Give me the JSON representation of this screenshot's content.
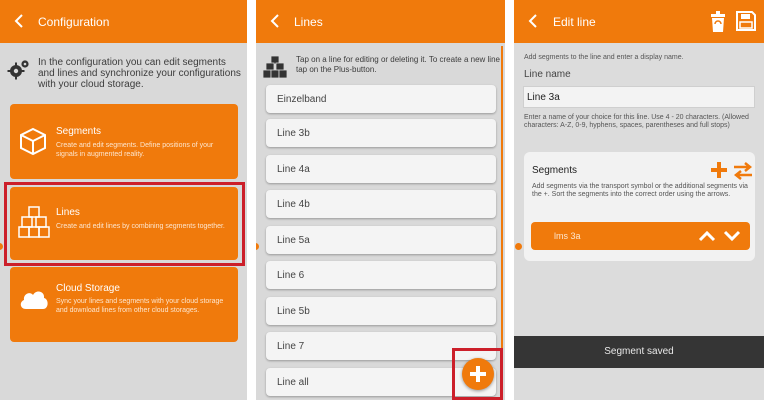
{
  "colors": {
    "accent": "#f07a0c",
    "highlight": "#cc1f2a",
    "toast_bg": "#353535"
  },
  "screen1": {
    "title": "Configuration",
    "intro": "In the configuration you can edit segments and lines and synchronize your configurations with your cloud storage.",
    "cards": [
      {
        "title": "Segments",
        "desc": "Create and edit segments. Define positions of your signals in augmented reality.",
        "icon": "cube-icon"
      },
      {
        "title": "Lines",
        "desc": "Create and edit lines by combining segments together.",
        "icon": "stacked-cubes-icon",
        "highlighted": true
      },
      {
        "title": "Cloud Storage",
        "desc": "Sync your lines and segments with your cloud storage and download lines from other cloud storages.",
        "icon": "cloud-icon"
      }
    ]
  },
  "screen2": {
    "title": "Lines",
    "intro": "Tap on a line for editing or deleting it. To create a new line tap on the Plus-button.",
    "lines": [
      "Einzelband",
      "Line 3b",
      "Line 4a",
      "Line 4b",
      "Line 5a",
      "Line 6",
      "Line 5b",
      "Line 7",
      "Line all"
    ],
    "fab_icon": "plus-icon"
  },
  "screen3": {
    "title": "Edit line",
    "intro": "Add segments to the line and enter a display name.",
    "name_label": "Line name",
    "name_value": "Line 3a",
    "name_hint": "Enter a name of your choice for this line. Use 4 - 20 characters. (Allowed characters: A-Z, 0-9, hyphens, spaces, parentheses and full stops)",
    "segments_title": "Segments",
    "segments_hint": "Add segments via the transport symbol or the additional segments via the +. Sort the segments into the correct order using the arrows.",
    "segment_item": "lms 3a",
    "toast": "Segment saved"
  }
}
